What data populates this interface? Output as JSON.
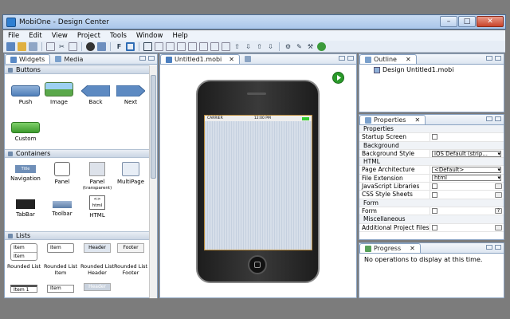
{
  "window": {
    "title": "MobiOne - Design Center",
    "min": "–",
    "max": "□",
    "close": "✕"
  },
  "menu": [
    "File",
    "Edit",
    "View",
    "Project",
    "Tools",
    "Window",
    "Help"
  ],
  "palette": {
    "tabs": [
      "Widgets",
      "Media"
    ],
    "sections": {
      "buttons": {
        "title": "Buttons",
        "items": [
          "Push",
          "Image",
          "Back",
          "Next",
          "Custom"
        ]
      },
      "containers": {
        "title": "Containers",
        "items": [
          "Navigation",
          "Panel",
          "Panel",
          "MultiPage",
          "TabBar",
          "Toolbar",
          "HTML"
        ],
        "panel_sub": "(transparent)",
        "nav_text": "Title",
        "html_text": "<>\nhtml"
      },
      "lists": {
        "title": "Lists",
        "items": [
          "Rounded List",
          "Rounded List Item",
          "Rounded List Header",
          "Rounded List Footer"
        ],
        "item_label": "Item",
        "header_label": "Header",
        "footer_label": "Footer",
        "item1_label": "Item 1"
      }
    }
  },
  "editor": {
    "tab": "Untitled1.mobi",
    "carrier": "CARRIER",
    "time": "12:00 PM"
  },
  "outline": {
    "tab": "Outline",
    "root": "Design Untitled1.mobi"
  },
  "properties": {
    "tab": "Properties",
    "rows": [
      {
        "k": "Properties",
        "cat": true
      },
      {
        "k": "Startup Screen",
        "t": "check"
      },
      {
        "k": "Background",
        "cat": true
      },
      {
        "k": "Background Style",
        "t": "select",
        "v": "iOS Default (strip..."
      },
      {
        "k": "HTML",
        "cat": true
      },
      {
        "k": "Page Architecture",
        "t": "select",
        "v": "<Default>"
      },
      {
        "k": "File Extension",
        "t": "select",
        "v": "html"
      },
      {
        "k": "JavaScript Libraries",
        "t": "checkdots"
      },
      {
        "k": "CSS Style Sheets",
        "t": "checkdots"
      },
      {
        "k": "Form",
        "cat": true
      },
      {
        "k": "Form",
        "t": "checkq",
        "q": "?"
      },
      {
        "k": "Miscellaneous",
        "cat": true
      },
      {
        "k": "Additional Project Files",
        "t": "checkdots"
      }
    ]
  },
  "progress": {
    "tab": "Progress",
    "message": "No operations to display at this time."
  },
  "colors": {
    "accent": "#2f7fd1",
    "play": "#2a9a2a"
  }
}
